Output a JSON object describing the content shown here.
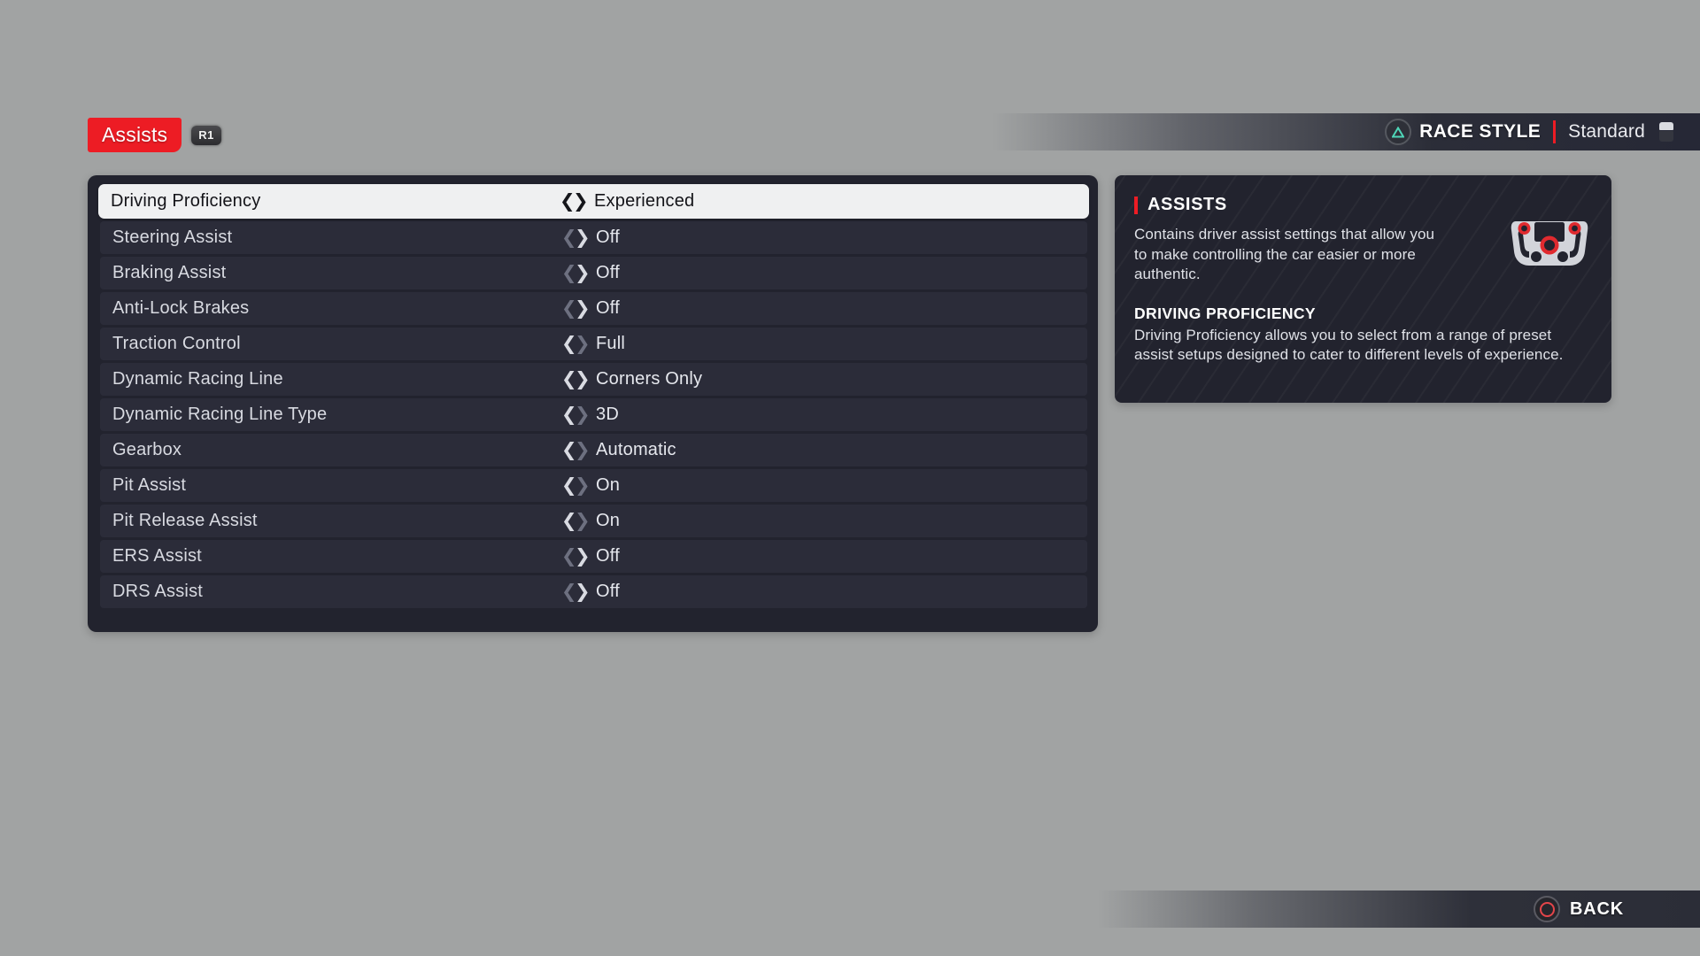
{
  "background_color": "#a1a3a3",
  "accent_color": "#ed1c24",
  "tabbar": {
    "active_tab": "Assists",
    "shoulder_button": "R1"
  },
  "race_style_header": {
    "button_icon": "ps-triangle-icon",
    "label": "RACE STYLE",
    "value": "Standard",
    "trailing_icon": "touchpad-icon"
  },
  "settings": {
    "rows": [
      {
        "label": "Driving Proficiency",
        "value": "Experienced",
        "selected": true,
        "left_enabled": true,
        "right_enabled": true
      },
      {
        "label": "Steering Assist",
        "value": "Off",
        "selected": false,
        "left_enabled": false,
        "right_enabled": true
      },
      {
        "label": "Braking Assist",
        "value": "Off",
        "selected": false,
        "left_enabled": false,
        "right_enabled": true
      },
      {
        "label": "Anti-Lock Brakes",
        "value": "Off",
        "selected": false,
        "left_enabled": false,
        "right_enabled": true
      },
      {
        "label": "Traction Control",
        "value": "Full",
        "selected": false,
        "left_enabled": true,
        "right_enabled": false
      },
      {
        "label": "Dynamic Racing Line",
        "value": "Corners Only",
        "selected": false,
        "left_enabled": true,
        "right_enabled": true
      },
      {
        "label": "Dynamic Racing Line Type",
        "value": "3D",
        "selected": false,
        "left_enabled": true,
        "right_enabled": false
      },
      {
        "label": "Gearbox",
        "value": "Automatic",
        "selected": false,
        "left_enabled": true,
        "right_enabled": false
      },
      {
        "label": "Pit Assist",
        "value": "On",
        "selected": false,
        "left_enabled": true,
        "right_enabled": false
      },
      {
        "label": "Pit Release Assist",
        "value": "On",
        "selected": false,
        "left_enabled": true,
        "right_enabled": false
      },
      {
        "label": "ERS Assist",
        "value": "Off",
        "selected": false,
        "left_enabled": false,
        "right_enabled": true
      },
      {
        "label": "DRS Assist",
        "value": "Off",
        "selected": false,
        "left_enabled": false,
        "right_enabled": true
      }
    ]
  },
  "info_panel": {
    "title": "ASSISTS",
    "description": "Contains driver assist settings that allow you to make controlling the car easier or more authentic.",
    "sub_title": "DRIVING PROFICIENCY",
    "sub_description": "Driving Proficiency allows you to select from a range of preset assist setups designed to cater to different levels of experience.",
    "icon": "steering-wheel-icon"
  },
  "footer": {
    "back_button_icon": "ps-circle-icon",
    "back_label": "BACK"
  }
}
